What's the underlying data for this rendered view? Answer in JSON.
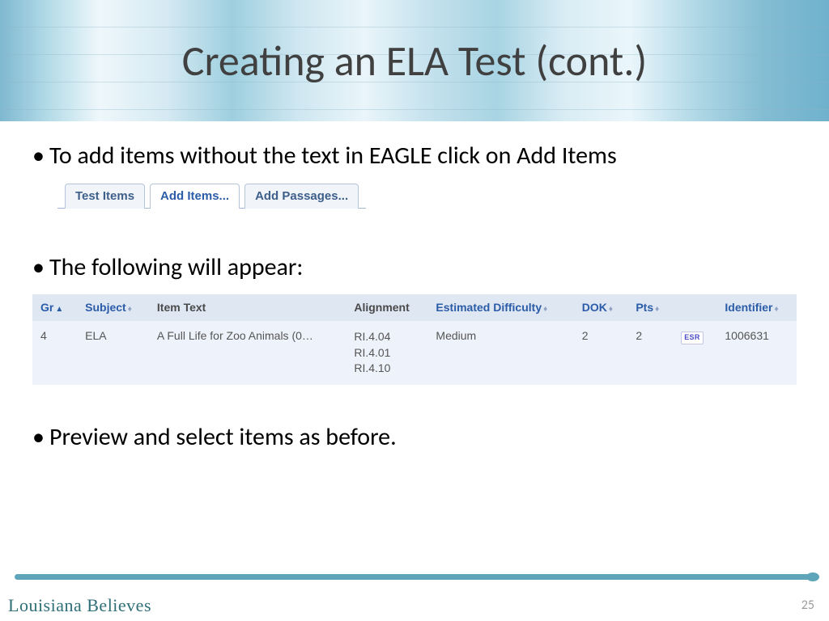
{
  "title": "Creating an ELA Test (cont.)",
  "bullets": {
    "b1": "To add items without the text in EAGLE click on Add Items",
    "b2": "The following will appear:",
    "b3": "Preview and select items as before."
  },
  "tabs": {
    "test_items": "Test Items",
    "add_items": "Add Items...",
    "add_passages": "Add Passages..."
  },
  "table": {
    "headers": {
      "gr": "Gr",
      "subject": "Subject",
      "item_text": "Item Text",
      "alignment": "Alignment",
      "est_diff": "Estimated Difficulty",
      "dok": "DOK",
      "pts": "Pts",
      "identifier": "Identifier"
    },
    "row": {
      "gr": "4",
      "subject": "ELA",
      "item_text": "A Full Life for Zoo Animals (0…",
      "alignment_1": "RI.4.04",
      "alignment_2": "RI.4.01",
      "alignment_3": "RI.4.10",
      "est_diff": "Medium",
      "dok": "2",
      "pts": "2",
      "badge": "ESR",
      "identifier": "1006631"
    }
  },
  "footer": {
    "brand": "Louisiana Believes",
    "page": "25"
  }
}
